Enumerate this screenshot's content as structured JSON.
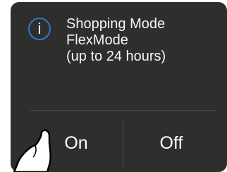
{
  "dialog": {
    "icon": "info-icon",
    "icon_glyph": "i",
    "message_lines": [
      "Shopping Mode",
      "FlexMode",
      "(up to 24 hours)"
    ]
  },
  "buttons": {
    "on_label": "On",
    "off_label": "Off"
  },
  "pointer": {
    "icon": "hand-pointer-icon"
  },
  "colors": {
    "screen_bg": "#2e2e2d",
    "text": "#ffffff",
    "accent": "#2f78c9"
  }
}
